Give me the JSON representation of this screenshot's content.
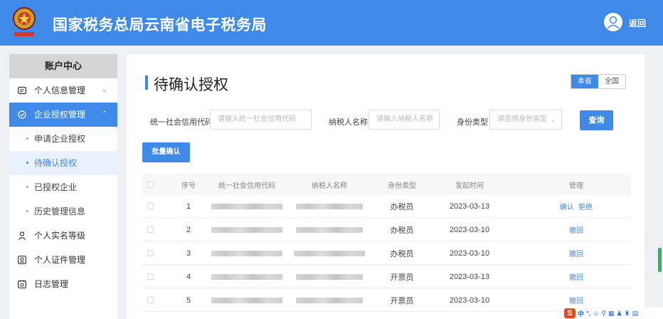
{
  "header": {
    "title": "国家税务总局云南省电子税务局",
    "back_label": "返回",
    "brand_color": "#3f8ae8"
  },
  "sidebar": {
    "header": "账户中心",
    "items": [
      {
        "label": "个人信息管理",
        "icon": "user-card-icon",
        "expanded": false
      },
      {
        "label": "企业授权管理",
        "icon": "enterprise-auth-icon",
        "expanded": true
      },
      {
        "label": "个人实名等级",
        "icon": "person-level-icon"
      },
      {
        "label": "个人证件管理",
        "icon": "id-card-icon"
      },
      {
        "label": "日志管理",
        "icon": "log-icon"
      }
    ],
    "sub_items": [
      {
        "label": "申请企业授权"
      },
      {
        "label": "待确认授权",
        "current": true
      },
      {
        "label": "已授权企业"
      },
      {
        "label": "历史管理信息"
      }
    ]
  },
  "main": {
    "title": "待确认授权",
    "region_toggle": {
      "options": [
        "本省",
        "全国"
      ],
      "selected": "本省"
    },
    "filters": {
      "credit_code_label": "统一社会信用代码",
      "credit_code_placeholder": "请输入统一社会信用代码",
      "taxpayer_name_label": "纳税人名称",
      "taxpayer_name_placeholder": "请输入纳税人名称",
      "identity_type_label": "身份类型",
      "identity_type_placeholder": "请选择身份类型"
    },
    "search_button": "查询",
    "batch_confirm_button": "批量确认",
    "table": {
      "columns": [
        "序号",
        "统一社会信用代码",
        "纳税人名称",
        "身份类型",
        "发起时间",
        "管理"
      ],
      "rows": [
        {
          "no": "1",
          "identity_type": "办税员",
          "time": "2023-03-13",
          "actions": [
            "确认",
            "拒绝"
          ]
        },
        {
          "no": "2",
          "identity_type": "办税员",
          "time": "2023-03-10",
          "actions": [
            "撤回"
          ]
        },
        {
          "no": "3",
          "identity_type": "办税员",
          "time": "2023-03-10",
          "actions": [
            "撤回"
          ]
        },
        {
          "no": "4",
          "identity_type": "开票员",
          "time": "2023-03-13",
          "actions": [
            "撤回"
          ]
        },
        {
          "no": "5",
          "identity_type": "开票员",
          "time": "2023-03-10",
          "actions": [
            "撤回"
          ]
        }
      ]
    }
  },
  "tray": {
    "ime_label": "中"
  }
}
